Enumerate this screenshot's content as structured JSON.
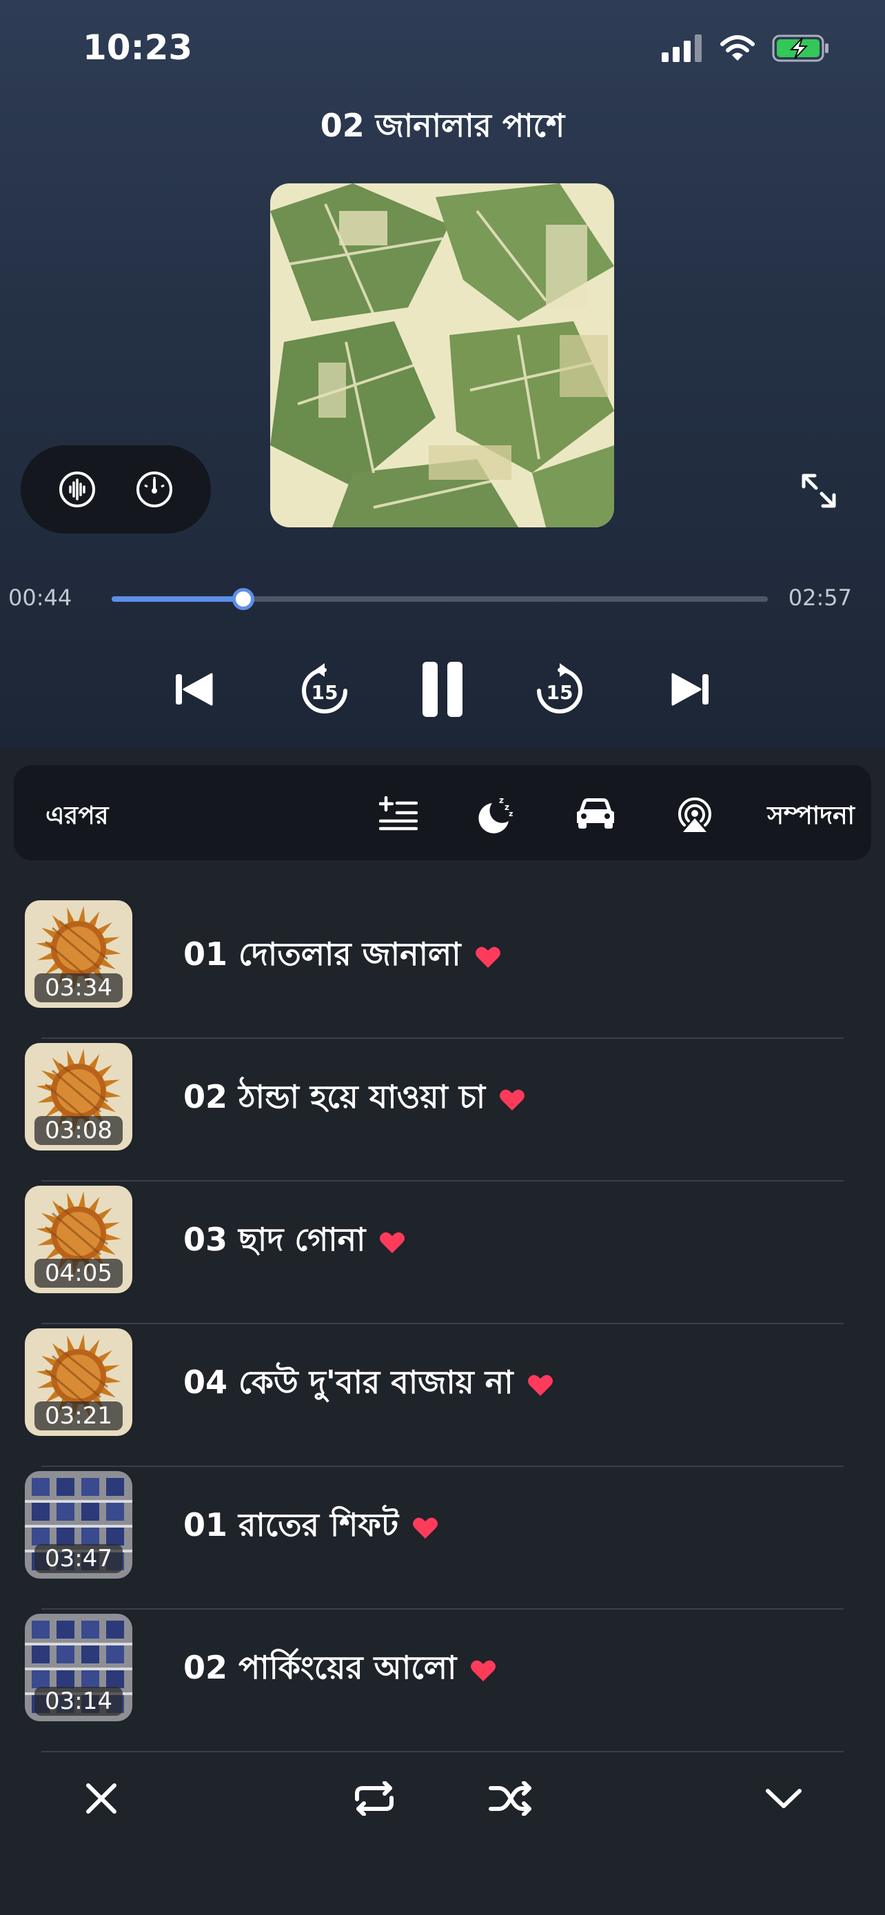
{
  "status": {
    "time": "10:23"
  },
  "player": {
    "title": "02 জানালার পাশে",
    "elapsed": "00:44",
    "duration": "02:57",
    "progress_fraction": 0.201,
    "skip_back_seconds": "15",
    "skip_forward_seconds": "15",
    "accent": "#5d8fe8"
  },
  "toolbar": {
    "label": "এরপর",
    "edit_label": "সম্পাদনা",
    "icons": [
      "add-to-queue-icon",
      "sleep-timer-icon",
      "car-mode-icon",
      "airplay-icon"
    ]
  },
  "queue": [
    {
      "title": "01 দোতলার জানালা",
      "duration": "03:34",
      "art": "sun",
      "favorite": true
    },
    {
      "title": "02 ঠান্ডা হয়ে যাওয়া চা",
      "duration": "03:08",
      "art": "sun",
      "favorite": true
    },
    {
      "title": "03 ছাদ গোনা",
      "duration": "04:05",
      "art": "sun",
      "favorite": true
    },
    {
      "title": "04 কেউ দু'বার বাজায় না",
      "duration": "03:21",
      "art": "sun",
      "favorite": true
    },
    {
      "title": "01 রাতের শিফট",
      "duration": "03:47",
      "art": "building",
      "favorite": true
    },
    {
      "title": "02 পার্কিংয়ের আলো",
      "duration": "03:14",
      "art": "building",
      "favorite": true
    }
  ],
  "bottom_bar": {
    "icons": [
      "close-icon",
      "repeat-icon",
      "shuffle-icon",
      "chevron-down-icon"
    ]
  },
  "colors": {
    "heart": "#ff3b5c",
    "background": "#1f232a"
  }
}
